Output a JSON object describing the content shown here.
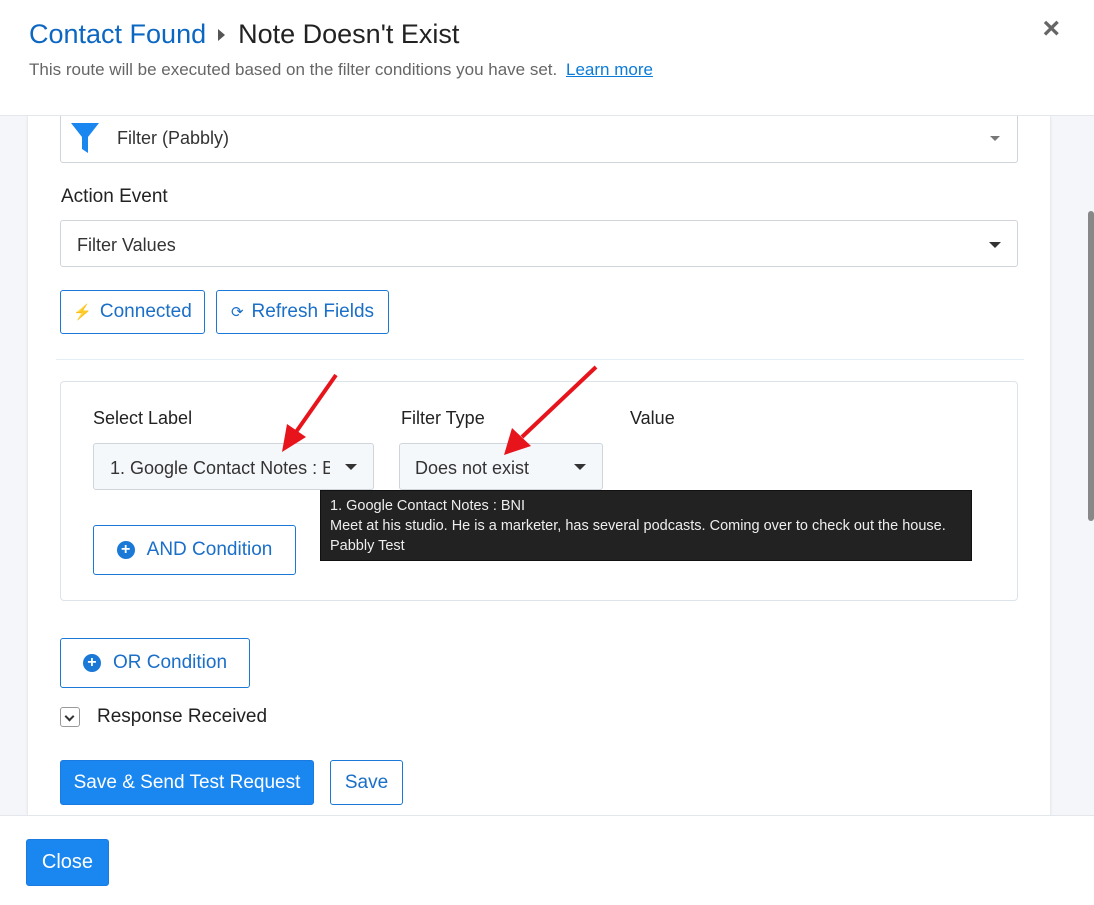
{
  "header": {
    "breadcrumb_parent": "Contact Found",
    "breadcrumb_current": "Note Doesn't Exist",
    "subtitle": "This route will be executed based on the filter conditions you have set.",
    "learn_more": "Learn more",
    "close_icon": "close-x-icon"
  },
  "app": {
    "selected": "Filter (Pabbly)",
    "icon": "funnel-icon",
    "icon_color": "#1a86f0"
  },
  "action_event": {
    "label": "Action Event",
    "selected": "Filter Values"
  },
  "buttons": {
    "connected": "Connected",
    "refresh": "Refresh Fields",
    "and_condition": "AND Condition",
    "or_condition": "OR Condition",
    "save_send": "Save & Send Test Request",
    "save": "Save",
    "close": "Close"
  },
  "filter": {
    "select_label_header": "Select Label",
    "filter_type_header": "Filter Type",
    "value_header": "Value",
    "selected_label": "1. Google Contact Notes : BNI",
    "selected_type": "Does not exist"
  },
  "tooltip": {
    "line1": "1. Google Contact Notes : BNI",
    "line2": "Meet at his studio. He is a marketer, has several podcasts. Coming over to check out the house.",
    "line3": "Pabbly Test"
  },
  "response": {
    "label": "Response Received"
  },
  "colors": {
    "accent": "#1a86f0",
    "link": "#0b67c2",
    "annotation_arrow": "#e8141b"
  }
}
